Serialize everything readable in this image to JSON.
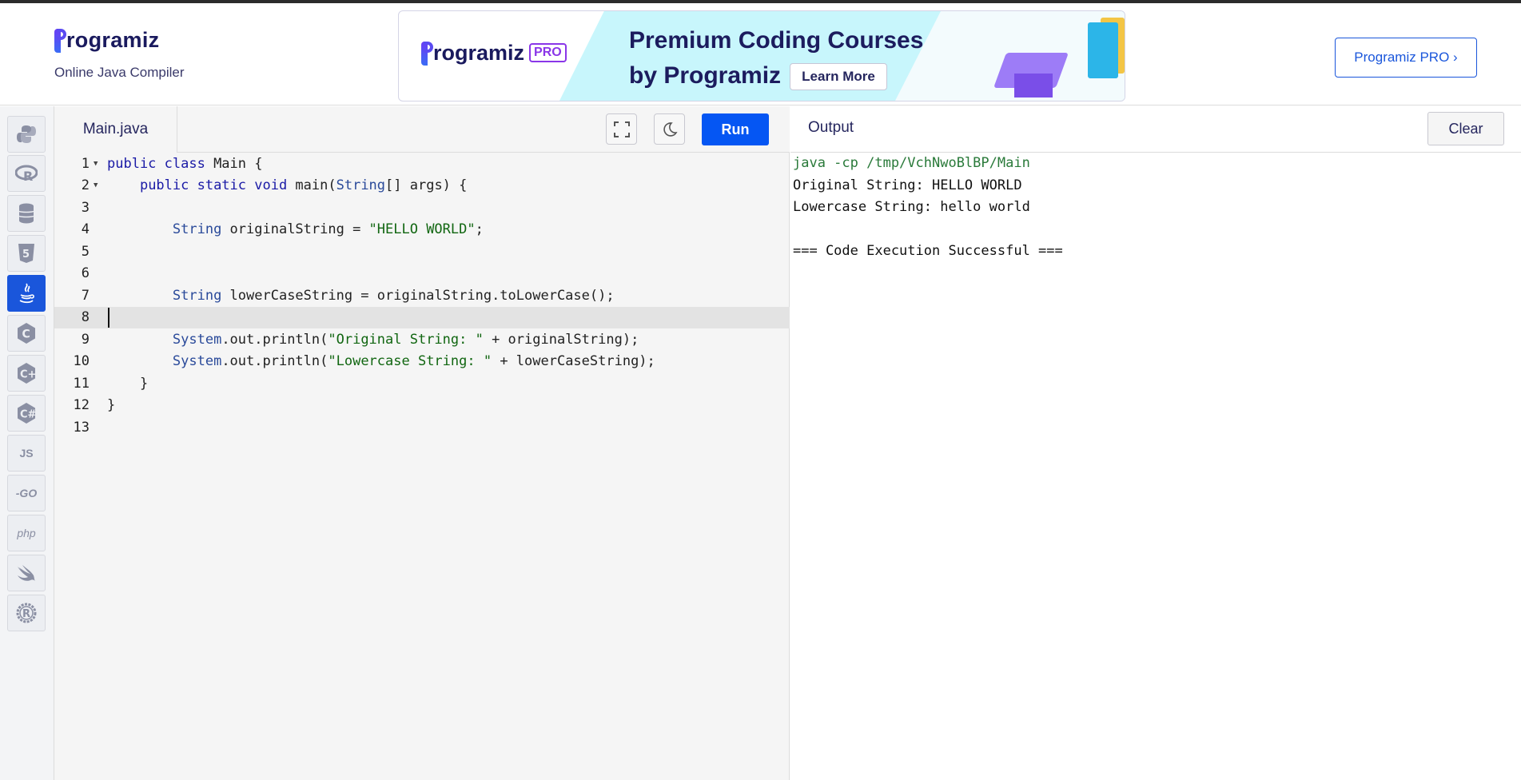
{
  "header": {
    "logo_text": "rogramiz",
    "subtitle": "Online Java Compiler",
    "pro_button": "Programiz PRO ›"
  },
  "ad": {
    "logo_text": "rogramiz",
    "pro_badge": "PRO",
    "line1": "Premium Coding Courses",
    "line2": "by Programiz",
    "cta": "Learn More"
  },
  "sidebar": {
    "items": [
      {
        "name": "python",
        "label": ""
      },
      {
        "name": "r",
        "label": "R"
      },
      {
        "name": "sql",
        "label": ""
      },
      {
        "name": "html",
        "label": "5"
      },
      {
        "name": "java",
        "label": "☕",
        "active": true
      },
      {
        "name": "c",
        "label": "C"
      },
      {
        "name": "cpp",
        "label": "C+"
      },
      {
        "name": "csharp",
        "label": "C#"
      },
      {
        "name": "javascript",
        "label": "JS"
      },
      {
        "name": "go",
        "label": "-GO"
      },
      {
        "name": "php",
        "label": "php"
      },
      {
        "name": "swift",
        "label": "➶"
      },
      {
        "name": "rust",
        "label": "R"
      }
    ]
  },
  "editor": {
    "tab": "Main.java",
    "run_label": "Run",
    "active_line": 8,
    "lines": [
      {
        "n": "1",
        "fold": true,
        "text": "public class Main {"
      },
      {
        "n": "2",
        "fold": true,
        "text": "    public static void main(String[] args) {"
      },
      {
        "n": "3",
        "fold": false,
        "text": ""
      },
      {
        "n": "4",
        "fold": false,
        "text": "        String originalString = \"HELLO WORLD\";"
      },
      {
        "n": "5",
        "fold": false,
        "text": ""
      },
      {
        "n": "6",
        "fold": false,
        "text": ""
      },
      {
        "n": "7",
        "fold": false,
        "text": "        String lowerCaseString = originalString.toLowerCase();"
      },
      {
        "n": "8",
        "fold": false,
        "text": ""
      },
      {
        "n": "9",
        "fold": false,
        "text": "        System.out.println(\"Original String: \" + originalString);"
      },
      {
        "n": "10",
        "fold": false,
        "text": "        System.out.println(\"Lowercase String: \" + lowerCaseString);"
      },
      {
        "n": "11",
        "fold": false,
        "text": "    }"
      },
      {
        "n": "12",
        "fold": false,
        "text": "}"
      },
      {
        "n": "13",
        "fold": false,
        "text": ""
      }
    ]
  },
  "output": {
    "title": "Output",
    "clear_label": "Clear",
    "lines": [
      {
        "text": "java -cp /tmp/VchNwoBlBP/Main",
        "cmd": true
      },
      {
        "text": "Original String: HELLO WORLD",
        "cmd": false
      },
      {
        "text": "Lowercase String: hello world",
        "cmd": false
      },
      {
        "text": "",
        "cmd": false
      },
      {
        "text": "=== Code Execution Successful ===",
        "cmd": false
      }
    ]
  },
  "colors": {
    "accent": "#0556f3",
    "brand": "#1a56db",
    "keyword": "#1a1aa6",
    "string": "#116611",
    "command": "#2a7a3a"
  }
}
